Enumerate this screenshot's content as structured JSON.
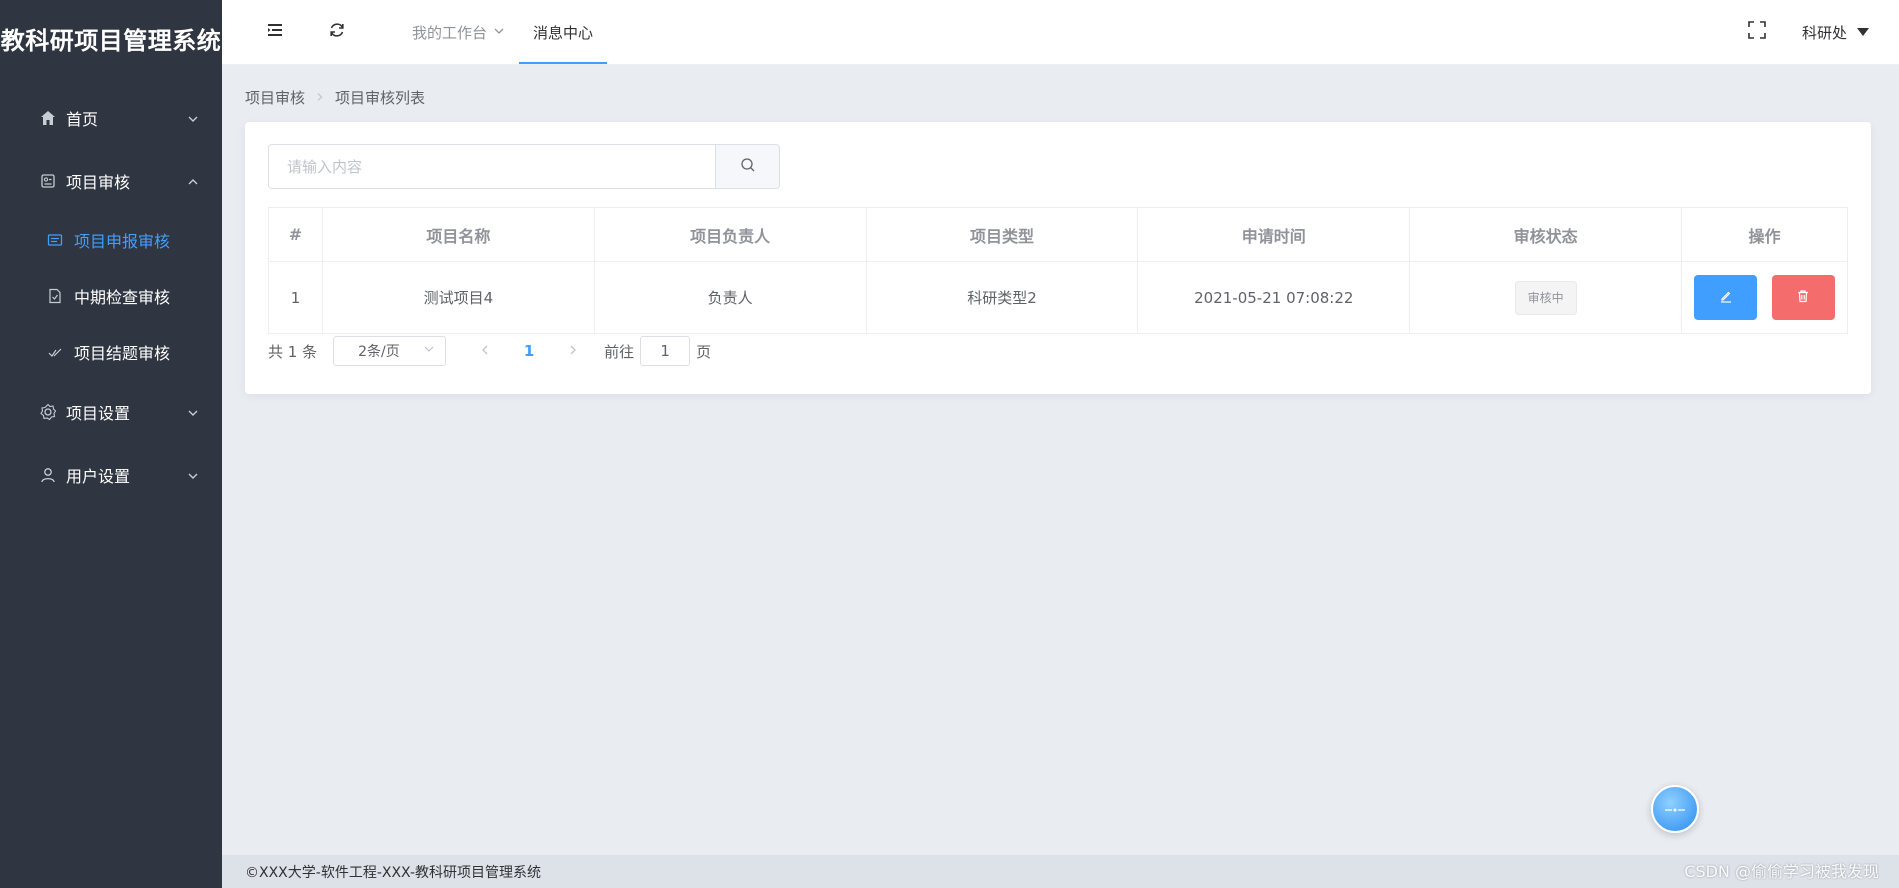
{
  "app": {
    "title": "教科研项目管理系统"
  },
  "sidebar": {
    "items": [
      {
        "label": "首页",
        "icon": "home-icon",
        "expanded": false
      },
      {
        "label": "项目审核",
        "icon": "audit-icon",
        "expanded": true,
        "children": [
          {
            "label": "项目申报审核",
            "icon": "list-icon",
            "active": true
          },
          {
            "label": "中期检查审核",
            "icon": "doc-check-icon",
            "active": false
          },
          {
            "label": "项目结题审核",
            "icon": "check-icon",
            "active": false
          }
        ]
      },
      {
        "label": "项目设置",
        "icon": "gear-icon",
        "expanded": false
      },
      {
        "label": "用户设置",
        "icon": "user-icon",
        "expanded": false
      }
    ]
  },
  "header": {
    "tabs": [
      {
        "label": "我的工作台",
        "active": false,
        "has_dropdown": true
      },
      {
        "label": "消息中心",
        "active": true,
        "has_dropdown": false
      }
    ],
    "user": "科研处"
  },
  "breadcrumb": [
    "项目审核",
    "项目审核列表"
  ],
  "search": {
    "placeholder": "请输入内容",
    "value": ""
  },
  "table": {
    "columns": [
      "#",
      "项目名称",
      "项目负责人",
      "项目类型",
      "申请时间",
      "审核状态",
      "操作"
    ],
    "rows": [
      {
        "index": "1",
        "name": "测试项目4",
        "owner": "负责人",
        "type": "科研类型2",
        "time": "2021-05-21 07:08:22",
        "status": "审核中"
      }
    ]
  },
  "pagination": {
    "total": "共 1 条",
    "page_size": "2条/页",
    "current": "1",
    "goto_prefix": "前往",
    "goto_value": "1",
    "goto_suffix": "页"
  },
  "footer": {
    "text": "©XXX大学-软件工程-XXX-教科研项目管理系统"
  },
  "watermark": "CSDN @偷偷学习被我发现",
  "colors": {
    "sidebar_bg": "#2f3541",
    "accent": "#409eff",
    "danger": "#f56c6c",
    "page_bg": "#e9edf2"
  }
}
